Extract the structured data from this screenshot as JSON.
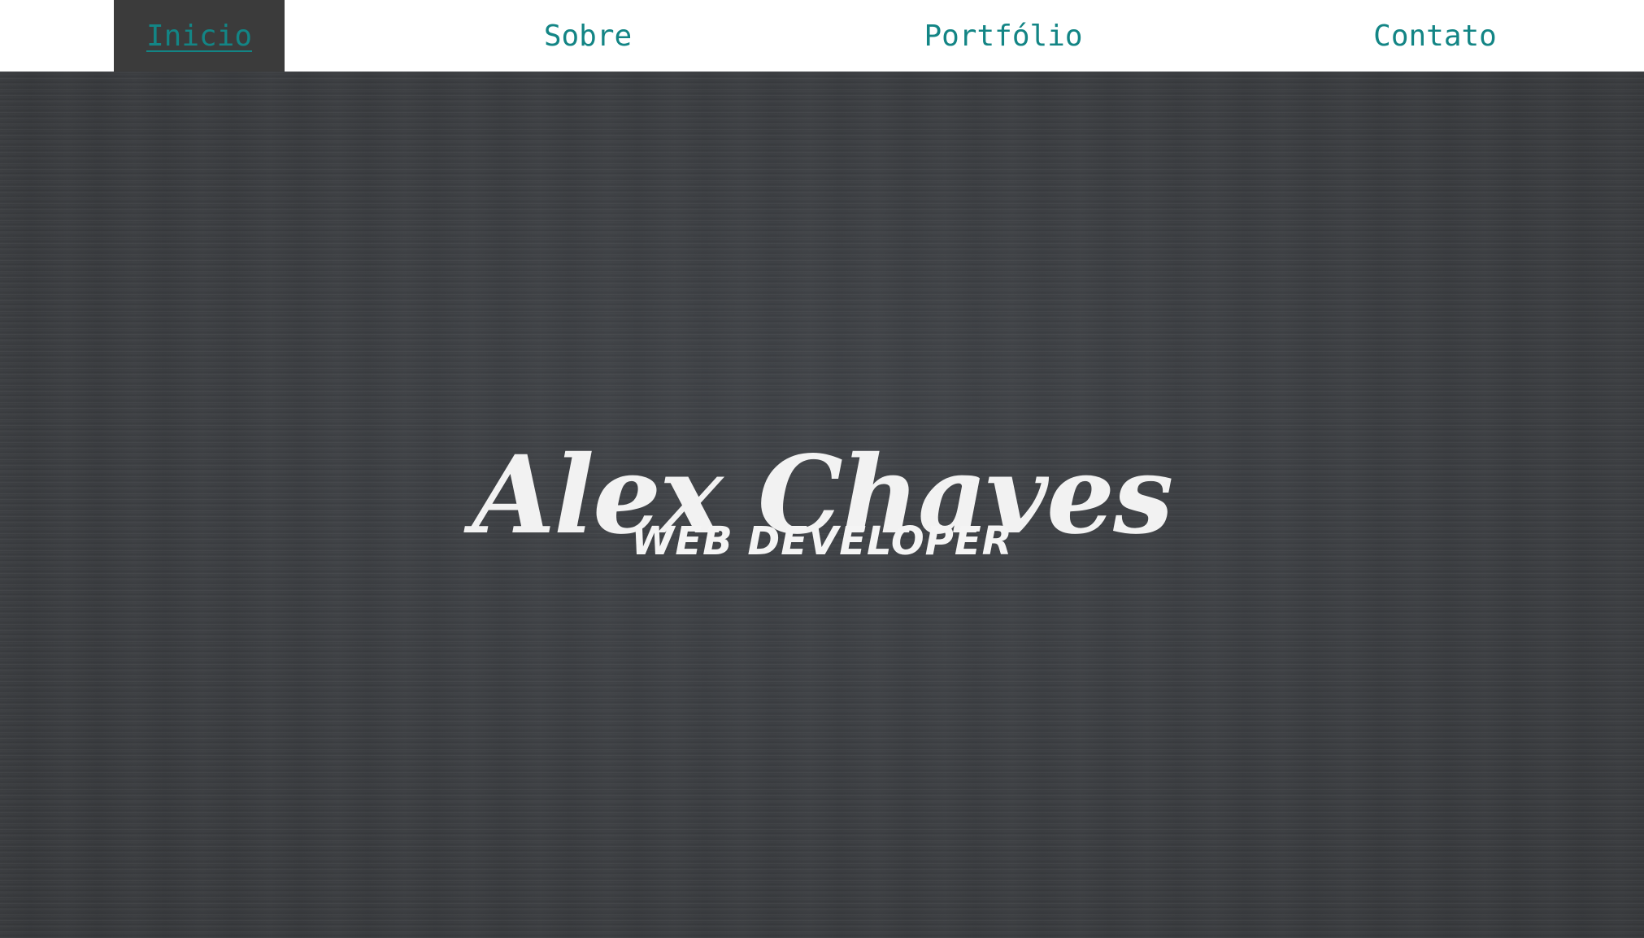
{
  "nav": {
    "items": [
      {
        "label": "Inicio",
        "active": true
      },
      {
        "label": "Sobre",
        "active": false
      },
      {
        "label": "Portfólio",
        "active": false
      },
      {
        "label": "Contato",
        "active": false
      }
    ]
  },
  "hero": {
    "title": "Alex Chaves",
    "subtitle": "web developer"
  },
  "colors": {
    "nav_background": "#ffffff",
    "nav_link": "#138585",
    "nav_active_background": "#3b3b3b",
    "hero_background": "#3b3d40",
    "hero_text": "#f2f2f2"
  }
}
